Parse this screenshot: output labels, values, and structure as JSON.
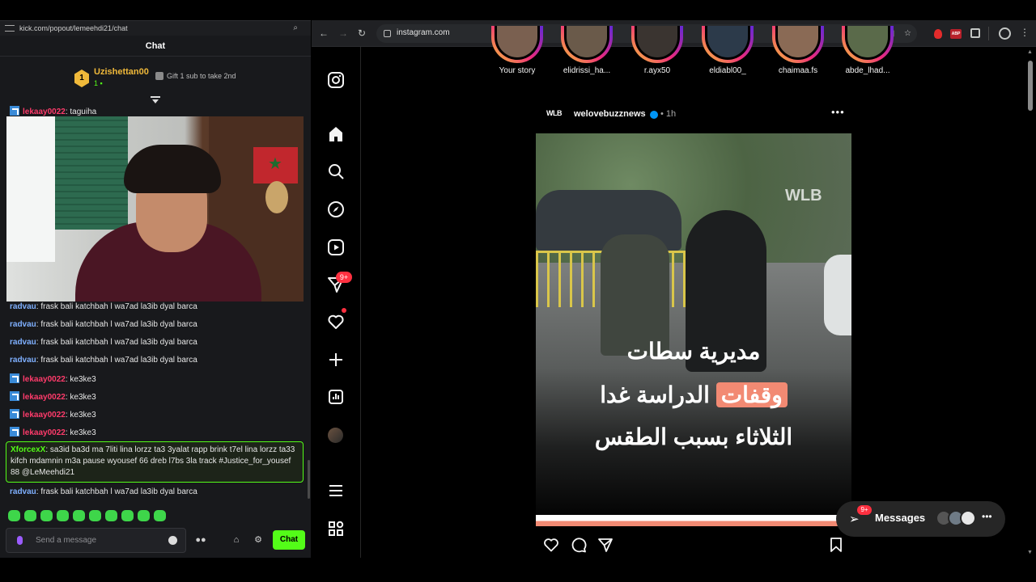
{
  "kick": {
    "url": "kick.com/popout/lemeehdi21/chat",
    "title": "Chat",
    "pinned": {
      "rank": "1",
      "username": "Uzishettan00",
      "count": "1",
      "gift_text": "Gift 1 sub to take 2nd"
    },
    "top_message": {
      "user": "lekaay0022",
      "text": ": taguiha"
    },
    "messages": [
      {
        "user": "radvau",
        "text": ": frask bali katchbah l wa7ad la3ib dyal barca"
      },
      {
        "user": "radvau",
        "text": ": frask bali katchbah l wa7ad la3ib dyal barca"
      },
      {
        "user": "radvau",
        "text": ": frask bali katchbah l wa7ad la3ib dyal barca"
      },
      {
        "user": "radvau",
        "text": ": frask bali katchbah l wa7ad la3ib dyal barca"
      },
      {
        "user": "lekaay0022",
        "text": ": ke3ke3"
      },
      {
        "user": "lekaay0022",
        "text": ": ke3ke3"
      },
      {
        "user": "lekaay0022",
        "text": ": ke3ke3"
      },
      {
        "user": "lekaay0022",
        "text": ": ke3ke3"
      }
    ],
    "highlight": {
      "user": "XforcexX",
      "text": ": sa3id ba3d ma 7liti lina lorzz ta3 3yalat rapp brink t7el lina lorzz ta33 kifch mdamnin m3a pause wyousef 66 dreb l7bs 3la track #Justice_for_yousef 88 @LeMeehdi21"
    },
    "last_message": {
      "user": "radvau",
      "text": ": frask bali katchbah l wa7ad la3ib dyal barca"
    },
    "input_placeholder": "Send a message",
    "chat_button": "Chat",
    "colors": {
      "accent": "#53fc18",
      "gold": "#f0b93a",
      "red_user": "#ff3b6b",
      "blue_user": "#7fb0ff"
    }
  },
  "browser": {
    "url": "instagram.com",
    "extension_abp": "ABP"
  },
  "instagram": {
    "nav_badge": "9+",
    "stories": [
      {
        "name": "Your story"
      },
      {
        "name": "elidrissi_ha..."
      },
      {
        "name": "r.ayx50"
      },
      {
        "name": "eldiabl00_"
      },
      {
        "name": "chaimaa.fs"
      },
      {
        "name": "abde_lhad..."
      }
    ],
    "post": {
      "logo": "WLB",
      "username": "welovebuzznews",
      "time": "• 1h",
      "watermark": "WLB",
      "line1": "مديرية سطات",
      "line2_highlight": "وقفات",
      "line2_rest": "الدراسة غدا",
      "line3": "الثلاثاء بسبب الطقس"
    },
    "messages_pill": {
      "label": "Messages",
      "badge": "9+"
    }
  }
}
